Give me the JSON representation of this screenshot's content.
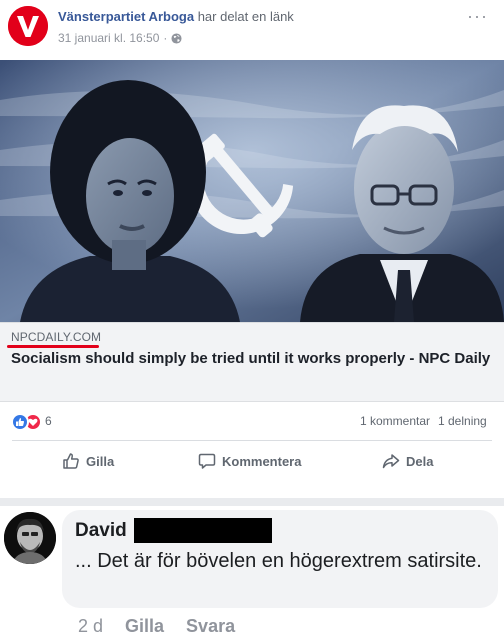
{
  "post": {
    "page_name": "Vänsterpartiet Arboga",
    "action_text": "har delat en länk",
    "timestamp": "31 januari kl. 16:50",
    "avatar_letter": "V",
    "more_label": "···"
  },
  "link_preview": {
    "domain": "NPCDAILY.COM",
    "title": "Socialism should simply be tried until it works properly - NPC Daily"
  },
  "engagement": {
    "reaction_count": "6",
    "comments": "1 kommentar",
    "shares": "1 delning"
  },
  "actions": {
    "like": "Gilla",
    "comment": "Kommentera",
    "share": "Dela"
  },
  "comment": {
    "author": "David",
    "text": "... Det är för bövelen en högerextrem satirsite.",
    "age": "2 d",
    "like": "Gilla",
    "reply": "Svara"
  },
  "colors": {
    "brand_red": "#e2001a",
    "link_blue": "#385898",
    "like_blue": "#3578e5",
    "love_red": "#f0284a"
  },
  "icons": [
    "globe-icon",
    "more-icon",
    "like-reaction-icon",
    "love-reaction-icon",
    "thumbs-up-icon",
    "comment-icon",
    "share-icon",
    "hammer-sickle-icon"
  ]
}
